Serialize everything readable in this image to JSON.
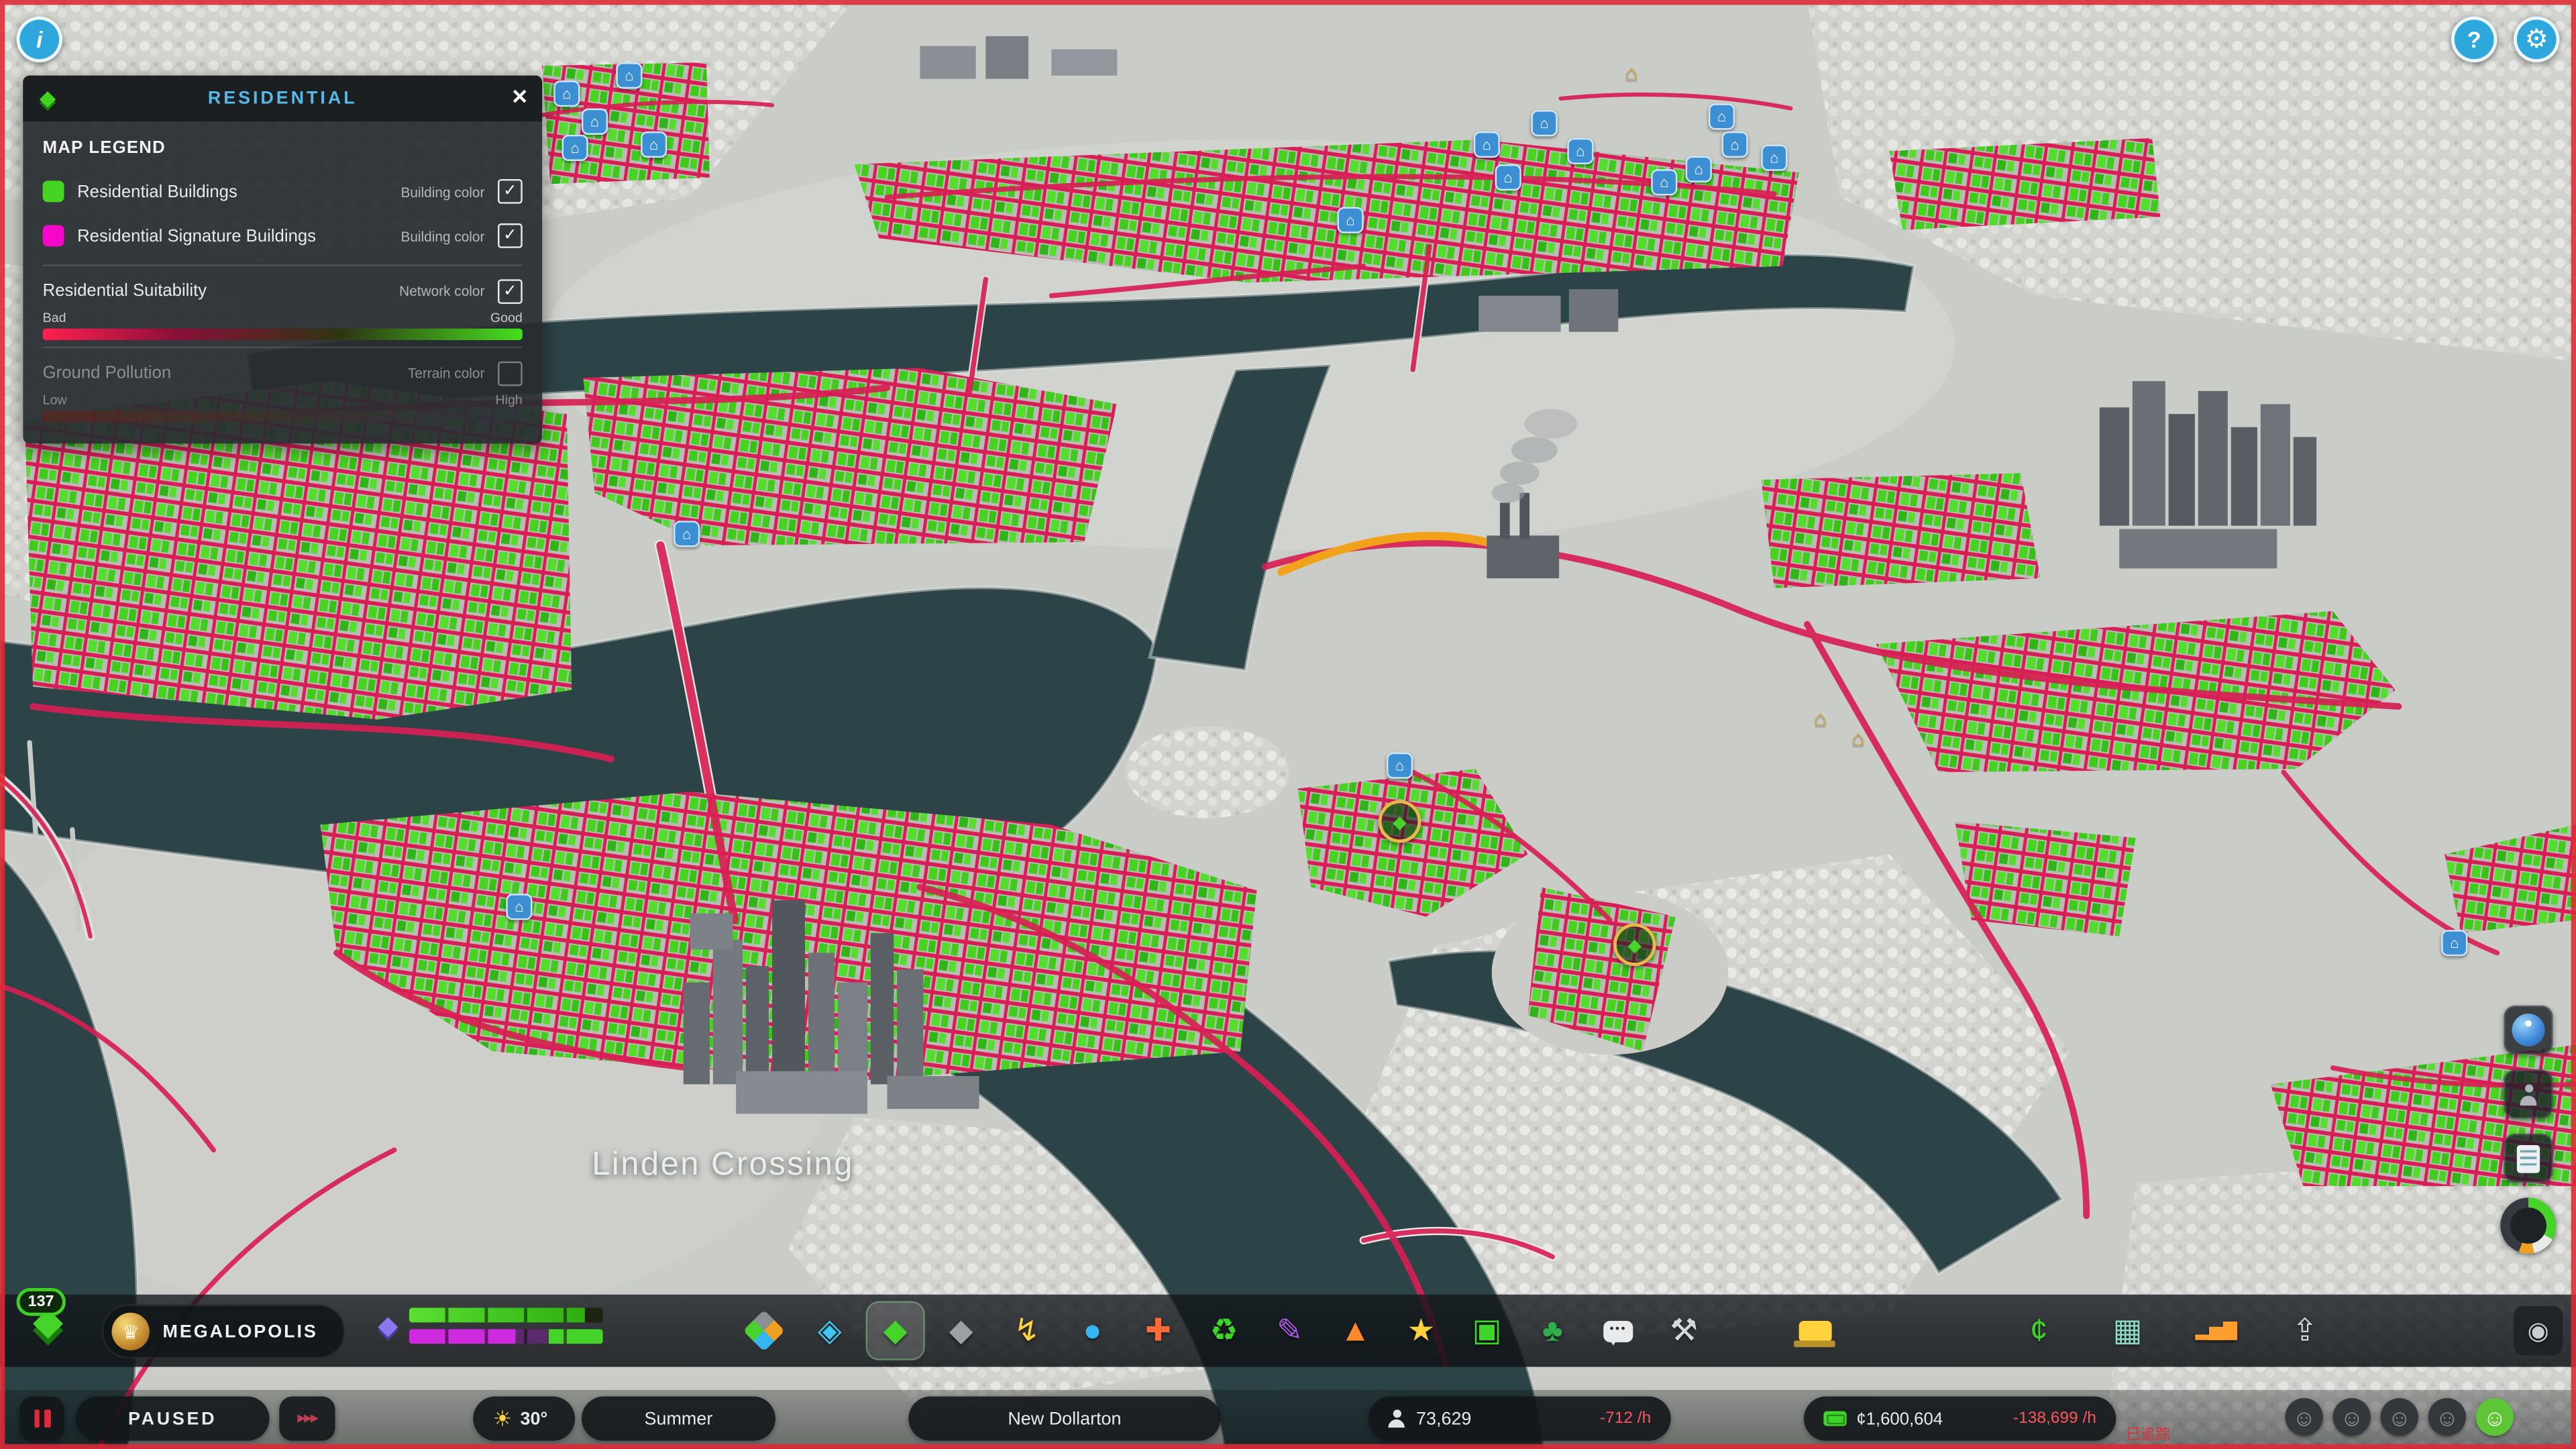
{
  "topbar": {
    "info_button_glyph": "i",
    "help_button_glyph": "?",
    "settings_button_glyph": "⚙"
  },
  "panel": {
    "icon_glyph": "◆",
    "title": "RESIDENTIAL",
    "close_glyph": "×",
    "legend_title": "MAP LEGEND",
    "check_glyph": "✓",
    "rows": [
      {
        "label": "Residential Buildings",
        "color_type": "Building color",
        "swatch": "#45d420",
        "checked": true
      },
      {
        "label": "Residential Signature Buildings",
        "color_type": "Building color",
        "swatch": "#f506c8",
        "checked": true
      }
    ],
    "gradients": [
      {
        "label": "Residential Suitability",
        "color_type": "Network color",
        "min": "Bad",
        "max": "Good",
        "checked": true,
        "bar": "linear-gradient(90deg,#ff2050 0%,#8a1038 28%,#2e3512 62%,#45e01e 100%)",
        "disabled": false
      },
      {
        "label": "Ground Pollution",
        "color_type": "Terrain color",
        "min": "Low",
        "max": "High",
        "checked": false,
        "bar": "linear-gradient(90deg,#6a2018 0%,#433028 45%,#2a3640 100%)",
        "disabled": true
      }
    ]
  },
  "map": {
    "place_label": "Linden Crossing"
  },
  "toolbar": {
    "level_badge": "137",
    "level_icon_glyph": "◆",
    "milestone_label": "MEGALOPOLIS",
    "trophy_glyph": "♛",
    "xp_gem_glyph": "◆",
    "tools": [
      {
        "name": "zones-tool",
        "style": "zones"
      },
      {
        "name": "areas-tool",
        "glyph": "◈",
        "color": "#3fc6f0"
      },
      {
        "name": "infoviews-tool",
        "glyph": "◆",
        "color": "#46d42a",
        "active": true
      },
      {
        "name": "roads-tool",
        "glyph": "◆",
        "color": "#9aa0a6"
      },
      {
        "name": "electricity-tool",
        "glyph": "↯",
        "color": "#ffd23e"
      },
      {
        "name": "water-sewage-tool",
        "glyph": "●",
        "color": "#35b5f2"
      },
      {
        "name": "healthcare-tool",
        "glyph": "✚",
        "color": "#ff6a3a"
      },
      {
        "name": "garbage-tool",
        "glyph": "♻",
        "color": "#3fd42a"
      },
      {
        "name": "education-tool",
        "glyph": "✎",
        "color": "#b05ae8"
      },
      {
        "name": "fire-rescue-tool",
        "glyph": "▲",
        "color": "#ff8a2a"
      },
      {
        "name": "police-tool",
        "glyph": "★",
        "color": "#ffd23e"
      },
      {
        "name": "transportation-tool",
        "glyph": "▣",
        "color": "#3fd42a"
      },
      {
        "name": "parks-recreation-tool",
        "glyph": "♣",
        "color": "#2faf4a"
      },
      {
        "name": "communications-tool",
        "style": "bubble"
      },
      {
        "name": "landscaping-tool",
        "glyph": "⚒",
        "color": "#d5d8db"
      },
      {
        "name": "bulldozer-tool",
        "style": "dozer",
        "gap": 40
      }
    ],
    "right_tools": [
      {
        "name": "economy-tool",
        "glyph": "¢",
        "color": "#3fd42a"
      },
      {
        "name": "city-journal-tool",
        "glyph": "▦",
        "color": "#8fd8c8"
      },
      {
        "name": "statistics-tool",
        "glyph": "▂▅▇",
        "color": "#ff9d2e",
        "size": 11
      },
      {
        "name": "upload-tool",
        "glyph": "⇪",
        "color": "#cfd4d8"
      }
    ],
    "photo_tool": {
      "name": "photo-mode-tool",
      "glyph": "◉",
      "color": "#c8cdd2"
    }
  },
  "statusbar": {
    "pause_label": "PAUSED",
    "speed_glyph": "▸▸▸",
    "sun_glyph": "☀",
    "temperature": "30°",
    "season": "Summer",
    "city_name": "New Dollarton",
    "population": "73,629",
    "population_rate": "-712 /h",
    "money": "¢1,600,604",
    "money_rate": "-138,699 /h",
    "faces": [
      {
        "glyph": "☺",
        "bg": "#33383d",
        "fg": "#8f959b"
      },
      {
        "glyph": "☺",
        "bg": "#33383d",
        "fg": "#8f959b"
      },
      {
        "glyph": "☺",
        "bg": "#33383d",
        "fg": "#8f959b"
      },
      {
        "glyph": "☺",
        "bg": "#33383d",
        "fg": "#8f959b"
      },
      {
        "glyph": "☺",
        "bg": "#5ec636",
        "fg": "#ffffff"
      }
    ]
  },
  "watermark": "已追踪",
  "colors": {
    "accent_cyan": "#3db7e8",
    "overlay_green": "#45d420",
    "overlay_red": "#d81f55",
    "water": "#2c4347"
  }
}
